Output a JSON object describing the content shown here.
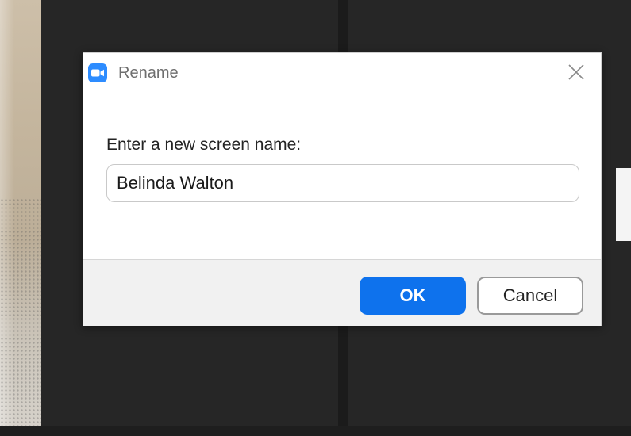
{
  "dialog": {
    "title": "Rename",
    "app_icon": "zoom-camera-icon",
    "close_icon": "close-icon",
    "prompt": "Enter a new screen name:",
    "name_value": "Belinda Walton",
    "ok_label": "OK",
    "cancel_label": "Cancel"
  },
  "colors": {
    "accent": "#0e72ed",
    "app_icon_bg": "#2d8cff",
    "background": "#232323"
  }
}
